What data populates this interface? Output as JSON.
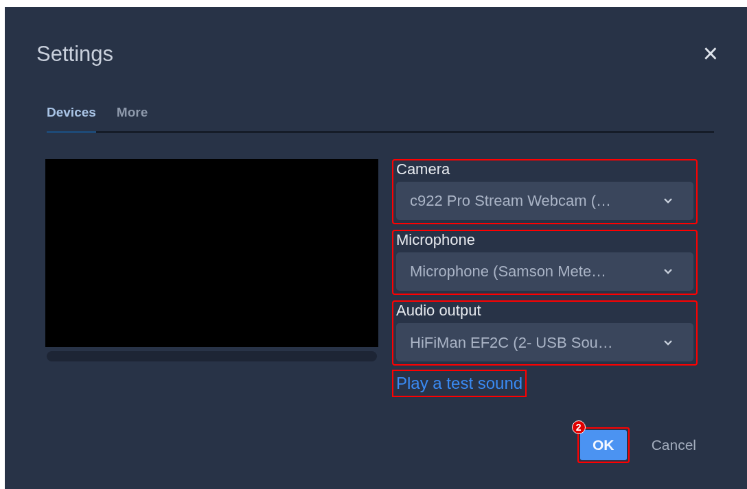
{
  "dialog": {
    "title": "Settings",
    "close": "×"
  },
  "tabs": [
    {
      "label": "Devices",
      "selected": true
    },
    {
      "label": "More",
      "selected": false
    }
  ],
  "meter": {
    "level": 0
  },
  "devices": [
    {
      "label": "Camera",
      "value": "c922 Pro Stream Webcam (…",
      "highlighted": true
    },
    {
      "label": "Microphone",
      "value": "Microphone (Samson Mete…",
      "highlighted": true
    },
    {
      "label": "Audio output",
      "value": "HiFiMan EF2C (2- USB Sou…",
      "highlighted": true
    }
  ],
  "test_sound": {
    "text": "Play a test sound",
    "highlighted": true
  },
  "buttons": [
    {
      "label": "OK",
      "kind": "primary",
      "highlighted": true,
      "badge": "2"
    },
    {
      "label": "Cancel",
      "kind": "link",
      "highlighted": false
    }
  ]
}
